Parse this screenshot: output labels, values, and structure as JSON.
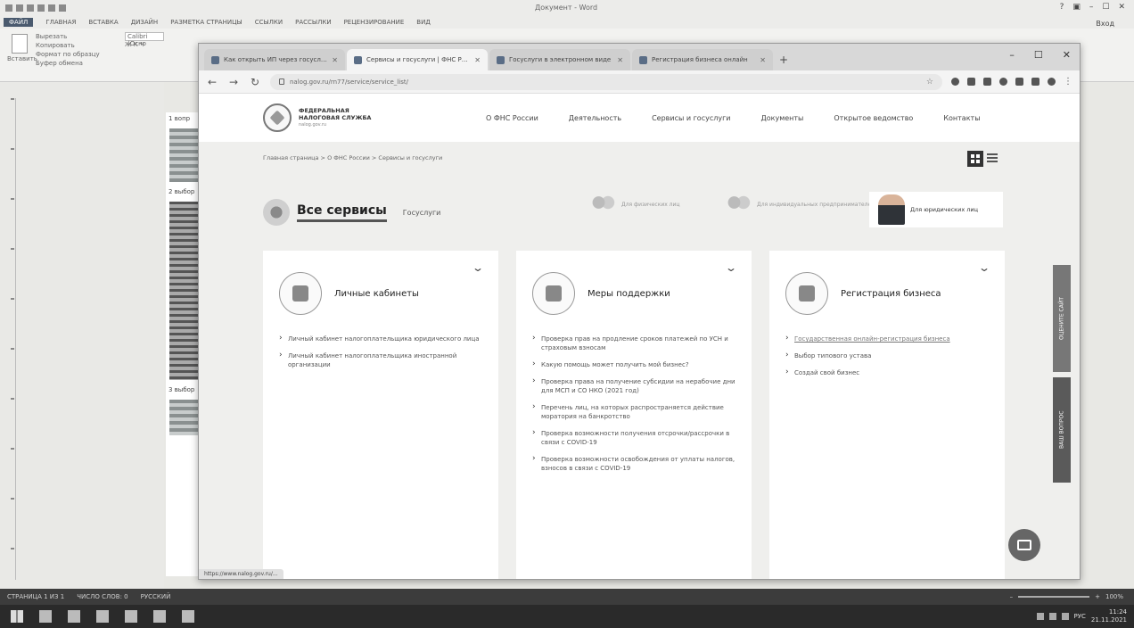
{
  "word": {
    "doc_title": "Документ - Word",
    "file_tab": "ФАЙЛ",
    "tabs": [
      "ГЛАВНАЯ",
      "ВСТАВКА",
      "ДИЗАЙН",
      "РАЗМЕТКА СТРАНИЦЫ",
      "ССЫЛКИ",
      "РАССЫЛКИ",
      "РЕЦЕНЗИРОВАНИЕ",
      "ВИД"
    ],
    "user": "Вход",
    "paste_label": "Вставить",
    "clipboard_lines": [
      "Вырезать",
      "Копировать",
      "Формат по образцу"
    ],
    "clipboard_group": "Буфер обмена",
    "font_name": "Calibri (Осно",
    "page_labels": [
      "1 вопр",
      "2 выбор",
      "3 выбор"
    ],
    "status": [
      "СТРАНИЦА 1 ИЗ 1",
      "ЧИСЛО СЛОВ: 0",
      "РУССКИЙ"
    ],
    "zoom": "100%"
  },
  "taskbar": {
    "clock_time": "11:24",
    "clock_date": "21.11.2021",
    "lang": "РУС"
  },
  "browser": {
    "tabs": [
      {
        "title": "Как открыть ИП через госуслуги?"
      },
      {
        "title": "Сервисы и госуслуги | ФНС России"
      },
      {
        "title": "Госуслуги в электронном виде"
      },
      {
        "title": "Регистрация бизнеса онлайн"
      }
    ],
    "url": "nalog.gov.ru/rn77/service/service_list/",
    "window_controls": [
      "–",
      "☐",
      "✕"
    ]
  },
  "site": {
    "logo_line1": "ФЕДЕРАЛЬНАЯ",
    "logo_line2": "НАЛОГОВАЯ СЛУЖБА",
    "logo_sub": "nalog.gov.ru",
    "nav": [
      "О ФНС России",
      "Деятельность",
      "Сервисы и госуслуги",
      "Документы",
      "Открытое ведомство",
      "Контакты"
    ],
    "breadcrumb": "Главная страница > О ФНС России > Сервисы и госуслуги",
    "all_services": "Все сервисы",
    "gosuslugi": "Госуслуги",
    "audience": [
      {
        "label": "Для физических лиц"
      },
      {
        "label": "Для индивидуальных предпринимателей"
      },
      {
        "label": "Для юридических лиц"
      }
    ],
    "cards": [
      {
        "title": "Личные кабинеты",
        "items": [
          "Личный кабинет налогоплательщика юридического лица",
          "Личный кабинет налогоплательщика иностранной организации"
        ]
      },
      {
        "title": "Меры поддержки",
        "items": [
          "Проверка прав на продление сроков платежей по УСН и страховым взносам",
          "Какую помощь может получить мой бизнес?",
          "Проверка права на получение субсидии на нерабочие дни для МСП и СО НКО (2021 год)",
          "Перечень лиц, на которых распространяется действие моратория на банкротство",
          "Проверка возможности получения отсрочки/рассрочки в связи с COVID-19",
          "Проверка возможности освобождения от уплаты налогов, взносов в связи с COVID-19"
        ]
      },
      {
        "title": "Регистрация бизнеса",
        "items": [
          "Государственная онлайн-регистрация бизнеса",
          "Выбор типового устава",
          "Создай свой бизнес"
        ]
      }
    ],
    "side_tabs": [
      "ОЦЕНИТЕ САЙТ",
      "ВАШ ВОПРОС"
    ],
    "status_url": "https://www.nalog.gov.ru/..."
  }
}
